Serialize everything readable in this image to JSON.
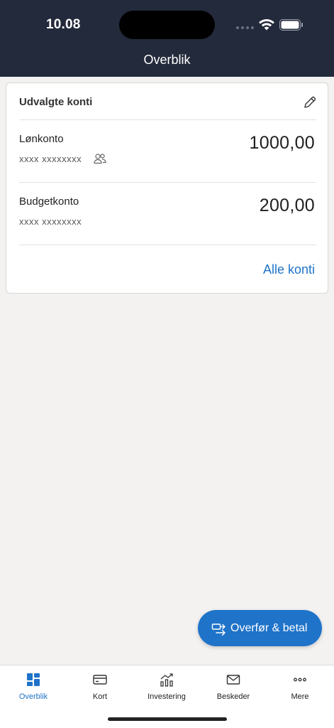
{
  "status": {
    "time": "10.08"
  },
  "header": {
    "title": "Overblik"
  },
  "card": {
    "title": "Udvalgte konti",
    "accounts": [
      {
        "name": "Lønkonto",
        "number": "xxxx xxxxxxxx",
        "amount": "1000,00",
        "shared": true
      },
      {
        "name": "Budgetkonto",
        "number": "xxxx xxxxxxxx",
        "amount": "200,00",
        "shared": false
      }
    ],
    "all_link": "Alle konti"
  },
  "fab": {
    "label": "Overfør & betal"
  },
  "tabs": [
    {
      "label": "Overblik",
      "icon": "dashboard-icon",
      "active": true
    },
    {
      "label": "Kort",
      "icon": "card-icon"
    },
    {
      "label": "Investering",
      "icon": "chart-icon"
    },
    {
      "label": "Beskeder",
      "icon": "mail-icon"
    },
    {
      "label": "Mere",
      "icon": "more-icon"
    }
  ],
  "colors": {
    "header": "#232a3b",
    "accent": "#1f73c9",
    "background": "#f3f2f1"
  }
}
